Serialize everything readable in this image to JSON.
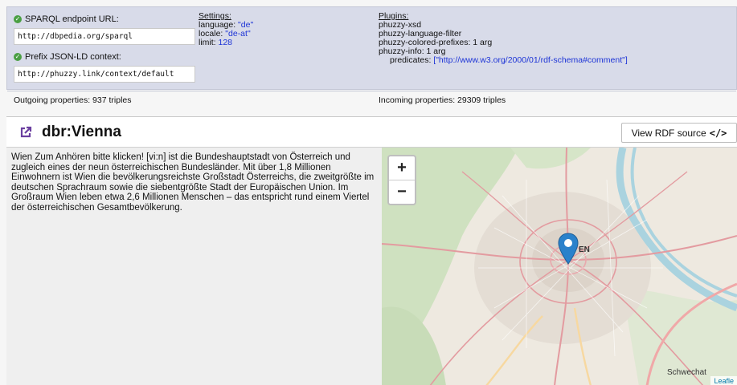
{
  "config": {
    "endpoint_label": "SPARQL endpoint URL:",
    "endpoint_value": "http://dbpedia.org/sparql",
    "prefix_label": "Prefix JSON-LD context:",
    "prefix_value": "http://phuzzy.link/context/default",
    "settings": {
      "title": "Settings:",
      "language_key": "language: ",
      "language_value": "\"de\"",
      "locale_key": "locale: ",
      "locale_value": "\"de-at\"",
      "limit_key": "limit: ",
      "limit_value": "128"
    },
    "plugins": {
      "title": "Plugins:",
      "items": [
        "phuzzy-xsd",
        "phuzzy-language-filter",
        "phuzzy-colored-prefixes: 1 arg",
        "phuzzy-info: 1 arg"
      ],
      "predicates_key": "predicates: ",
      "predicates_value": "[\"http://www.w3.org/2000/01/rdf-schema#comment\"]"
    },
    "outgoing": "Outgoing properties: 937 triples",
    "incoming": "Incoming properties: 29309 triples"
  },
  "resource": {
    "title": "dbr:Vienna",
    "view_source_label": "View RDF source",
    "view_source_glyph": "</>",
    "abstract": "Wien Zum Anhören bitte klicken! [vi:n] ist die Bundeshauptstadt von Österreich und zugleich eines der neun österreichischen Bundesländer. Mit über 1,8 Millionen Einwohnern ist Wien die bevölkerungsreichste Großstadt Österreichs, die zweitgrößte im deutschen Sprachraum sowie die siebentgrößte Stadt der Europäischen Union. Im Großraum Wien leben etwa 2,6 Millionen Menschen – das entspricht rund einem Viertel der österreichischen Gesamtbevölkerung."
  },
  "map": {
    "zoom_in": "+",
    "zoom_out": "−",
    "label_city": "EN",
    "label_schwechat": "Schwechat",
    "attribution": "Leafle",
    "marker_color": "#2a81cb"
  },
  "colors": {
    "panel_bg": "#d8dbe9",
    "check_green": "#4a9f43",
    "value_blue": "#1c33d6",
    "icon_purple": "#6b3fa0"
  }
}
